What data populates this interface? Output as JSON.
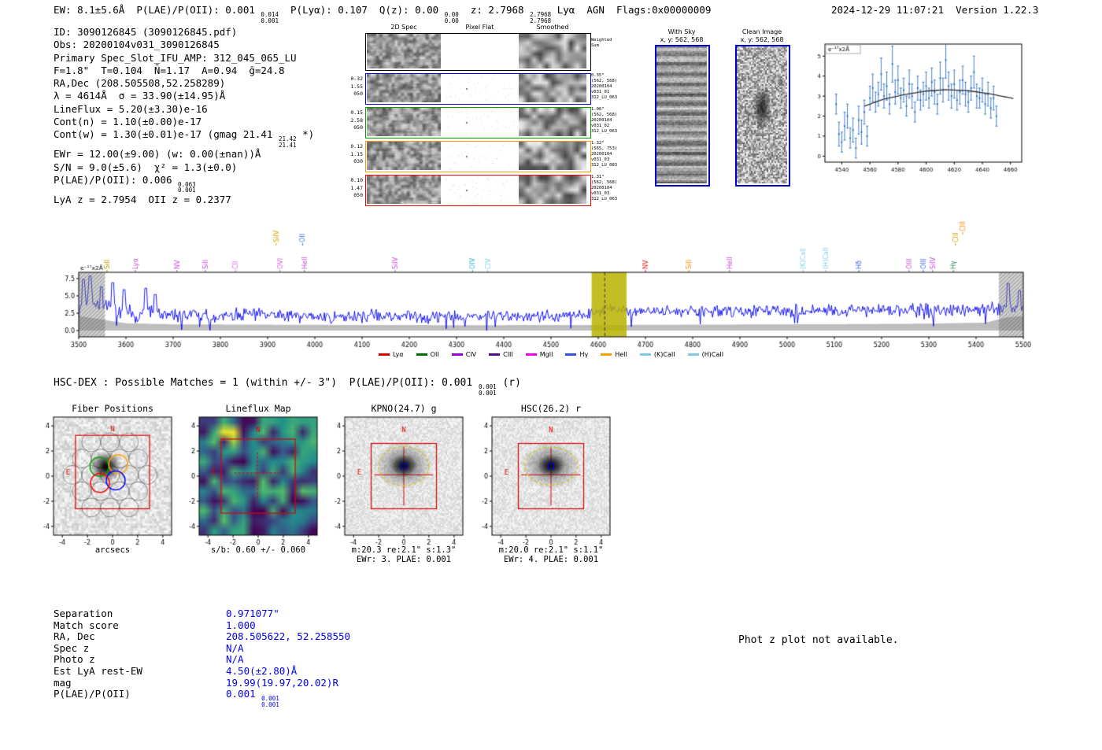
{
  "meta": {
    "datetime": "2024-12-29 11:07:21",
    "version": "Version 1.22.3"
  },
  "header": {
    "segments": [
      {
        "t": "EW: 8.1±5.6Å  P(LAE)/P(OII): 0.001 "
      },
      {
        "up": "0.014",
        "down": "0.001"
      },
      {
        "t": "  P(Lyα): 0.107  Q(z): 0.00 "
      },
      {
        "up": "0.00",
        "down": "0.00"
      },
      {
        "t": "  z: 2.7968 "
      },
      {
        "up": "2.7968",
        "down": "2.7968"
      },
      {
        "t": " Lyα  AGN  Flags:0x00000009"
      }
    ]
  },
  "info_block": {
    "lines": [
      [
        {
          "t": "ID: 3090126845 (3090126845.pdf)"
        }
      ],
      [
        {
          "t": "Obs: 20200104v031_3090126845"
        }
      ],
      [
        {
          "t": "Primary Spec_Slot_IFU_AMP: 312_045_065_LU"
        }
      ],
      [
        {
          "t": "F=1.8\"  T=0.104  N̄=1.17  A=0.94  ḡ=24.8"
        }
      ],
      [
        {
          "t": "RA,Dec (208.505508,52.258289)"
        }
      ],
      [
        {
          "t": "λ = 4614Å  σ = 33.90(±14.95)Å"
        }
      ],
      [
        {
          "t": "LineFlux = 5.20(±3.30)e-16"
        }
      ],
      [
        {
          "t": "Cont(n) = 1.10(±0.00)e-17"
        }
      ],
      [
        {
          "t": "Cont(w) = 1.30(±0.01)e-17 (gmag 21.41 "
        },
        {
          "up": "21.42",
          "down": "21.41"
        },
        {
          "t": " *)"
        }
      ],
      [
        {
          "t": "EWr = 12.00(±9.00) (w: 0.00(±nan))Å"
        }
      ],
      [
        {
          "t": "S/N = 9.0(±5.6)  χ² = 1.3(±0.0)"
        }
      ],
      [
        {
          "t": "P(LAE)/P(OII): 0.006 "
        },
        {
          "up": "0.063",
          "down": "0.001"
        }
      ],
      [
        {
          "t": "LyA z = 2.7954  OII z = 0.2377"
        }
      ]
    ]
  },
  "spec2d": {
    "col_headers": [
      "2D Spec",
      "Pixel Flat",
      "Smoothed"
    ],
    "weighted_row": {
      "right_label": [
        "Weighted",
        "Sum"
      ],
      "border": "#000000"
    },
    "rows": [
      {
        "left": [
          "0.32",
          "1.55",
          "050"
        ],
        "border": "#0000dd",
        "right": [
          "0.35\"",
          "(562, 568)",
          "20200104",
          "v031_01",
          "312_LU_063"
        ]
      },
      {
        "left": [
          "0.15",
          "2.58",
          "050"
        ],
        "border": "#00a000",
        "right": [
          "1.06\"",
          "(562, 568)",
          "20200104",
          "v031_02",
          "312_LU_063"
        ]
      },
      {
        "left": [
          "0.12",
          "1.15",
          "030"
        ],
        "border": "#ff9900",
        "right": [
          "1.32\"",
          "(565, 753)",
          "20200104",
          "v031_03",
          "312_LU_083"
        ]
      },
      {
        "left": [
          "0.10",
          "1.47",
          "050"
        ],
        "border": "#ee0000",
        "right": [
          "1.31\"",
          "(562, 568)",
          "20200104",
          "v031_03",
          "312_LU_063"
        ]
      }
    ]
  },
  "sky_panels": [
    {
      "title": "With Sky",
      "subtitle": "x, y: 562, 568",
      "border": "#0000cc"
    },
    {
      "title": "Clean Image",
      "subtitle": "x, y: 562, 568",
      "border": "#0000cc"
    }
  ],
  "hsc_line": {
    "segments": [
      {
        "t": "HSC-DEX : Possible Matches = 1 (within +/- 3\")  P(LAE)/P(OII): 0.001 "
      },
      {
        "up": "0.001",
        "down": "0.001"
      },
      {
        "t": " (r)"
      }
    ]
  },
  "cutouts": [
    {
      "title": "Fiber Positions",
      "xlabel": "arcsecs",
      "captions": []
    },
    {
      "title": "Lineflux Map",
      "captions": [
        "s/b: 0.60 +/- 0.060"
      ]
    },
    {
      "title": "KPNO(24.7) g",
      "captions": [
        "m:20.3 re:2.1\" s:1.3\"",
        "EWr: 3. PLAE: 0.001"
      ]
    },
    {
      "title": "HSC(26.2) r",
      "captions": [
        "m:20.0 re:2.1\" s:1.1\"",
        "EWr: 4. PLAE: 0.001"
      ]
    }
  ],
  "match_table": {
    "value_color": "#0000ee",
    "rows": [
      {
        "label": "Separation",
        "value": "0.971077\""
      },
      {
        "label": "Match score",
        "value": "1.000"
      },
      {
        "label": "RA, Dec",
        "value": "208.505622, 52.258550"
      },
      {
        "label": "Spec z",
        "value": "N/A"
      },
      {
        "label": "Photo z",
        "value": "N/A"
      },
      {
        "label": "Est LyA rest-EW",
        "value": "4.50(±2.80)Å"
      },
      {
        "label": "mag",
        "value": "19.99(19.97,20.02)R"
      },
      {
        "label": "P(LAE)/P(OII)",
        "value": "0.001",
        "stack": {
          "up": "0.001",
          "down": "0.001"
        }
      }
    ]
  },
  "notes": {
    "photz": "Phot z plot not available."
  },
  "chart_data": [
    {
      "id": "emission_line_fit_zoom",
      "type": "scatter",
      "ylabel_box": "e⁻¹⁷x2Å",
      "x_range": [
        4528,
        4668
      ],
      "y_range": [
        -0.3,
        5.6
      ],
      "x_ticks": [
        4540,
        4560,
        4580,
        4600,
        4620,
        4640,
        4660
      ],
      "y_ticks": [
        0,
        1,
        2,
        3,
        4,
        5
      ],
      "point_color": "#3070c0",
      "fit_color": "#303030",
      "x": [
        4536,
        4538,
        4540,
        4542,
        4544,
        4546,
        4548,
        4550,
        4552,
        4554,
        4556,
        4558,
        4560,
        4562,
        4564,
        4566,
        4568,
        4570,
        4572,
        4574,
        4576,
        4578,
        4580,
        4582,
        4584,
        4586,
        4588,
        4590,
        4592,
        4594,
        4596,
        4598,
        4600,
        4602,
        4604,
        4606,
        4608,
        4610,
        4612,
        4614,
        4616,
        4618,
        4620,
        4622,
        4624,
        4626,
        4628,
        4630,
        4632,
        4634,
        4636,
        4638,
        4640,
        4642,
        4644,
        4646,
        4648,
        4650
      ],
      "y": [
        2.6,
        1.1,
        0.7,
        1.5,
        2.0,
        0.9,
        1.3,
        0.4,
        1.8,
        1.2,
        2.2,
        1.0,
        2.9,
        3.4,
        2.7,
        3.1,
        4.1,
        3.0,
        3.5,
        2.6,
        4.6,
        3.2,
        3.8,
        2.9,
        3.3,
        2.5,
        3.6,
        3.0,
        2.2,
        3.4,
        2.8,
        3.1,
        3.5,
        2.9,
        3.7,
        3.2,
        2.6,
        3.9,
        3.3,
        4.8,
        3.5,
        3.0,
        3.6,
        2.8,
        3.2,
        3.8,
        3.1,
        2.7,
        3.4,
        4.2,
        3.0,
        2.9,
        3.3,
        2.6,
        3.1,
        2.4,
        2.9,
        2.0
      ],
      "yerr": [
        0.5,
        0.6,
        0.5,
        0.7,
        0.6,
        0.5,
        0.6,
        0.5,
        0.7,
        0.6,
        0.6,
        0.5,
        0.6,
        0.7,
        0.5,
        0.6,
        0.8,
        0.6,
        0.7,
        0.5,
        0.9,
        0.6,
        0.7,
        0.5,
        0.6,
        0.5,
        0.7,
        0.6,
        0.5,
        0.6,
        0.5,
        0.6,
        0.7,
        0.5,
        0.7,
        0.6,
        0.5,
        0.8,
        0.6,
        0.9,
        0.7,
        0.6,
        0.7,
        0.5,
        0.6,
        0.7,
        0.6,
        0.5,
        0.6,
        0.8,
        0.6,
        0.5,
        0.6,
        0.5,
        0.6,
        0.5,
        0.6,
        0.5
      ],
      "fit_curve": [
        [
          4556,
          2.5
        ],
        [
          4570,
          2.85
        ],
        [
          4585,
          3.08
        ],
        [
          4600,
          3.25
        ],
        [
          4614,
          3.32
        ],
        [
          4630,
          3.27
        ],
        [
          4645,
          3.12
        ],
        [
          4662,
          2.88
        ]
      ]
    },
    {
      "id": "full_width_spectrum",
      "type": "line",
      "ylabel": "e⁻¹⁷x2Å",
      "x_range": [
        3500,
        5500
      ],
      "y_range": [
        -0.9,
        8.4
      ],
      "x_ticks": [
        3500,
        3600,
        3700,
        3800,
        3900,
        4000,
        4100,
        4200,
        4300,
        4400,
        4500,
        4600,
        4700,
        4800,
        4900,
        5000,
        5100,
        5200,
        5300,
        5400,
        5500
      ],
      "y_ticks": [
        0.0,
        2.5,
        5.0,
        7.5
      ],
      "line_color": "#0000ee",
      "continuum_fill_color": "#bdbdbd",
      "noise_seed": 11,
      "mean_keypoints": [
        [
          3500,
          3.4
        ],
        [
          3520,
          4.2
        ],
        [
          3560,
          2.9
        ],
        [
          3620,
          2.5
        ],
        [
          3700,
          2.2
        ],
        [
          3800,
          2.1
        ],
        [
          3900,
          2.2
        ],
        [
          4000,
          2.0
        ],
        [
          4100,
          2.1
        ],
        [
          4250,
          2.0
        ],
        [
          4400,
          2.1
        ],
        [
          4520,
          2.0
        ],
        [
          4580,
          2.3
        ],
        [
          4614,
          3.1
        ],
        [
          4660,
          2.8
        ],
        [
          4750,
          2.7
        ],
        [
          4900,
          2.8
        ],
        [
          5050,
          2.8
        ],
        [
          5200,
          2.9
        ],
        [
          5350,
          2.9
        ],
        [
          5460,
          3.1
        ],
        [
          5500,
          3.3
        ]
      ],
      "noise_keypoints": [
        [
          3500,
          2.6
        ],
        [
          3560,
          2.2
        ],
        [
          3620,
          1.3
        ],
        [
          3700,
          1.1
        ],
        [
          4000,
          1.0
        ],
        [
          4400,
          0.9
        ],
        [
          4600,
          0.8
        ],
        [
          4700,
          0.95
        ],
        [
          5200,
          0.95
        ],
        [
          5420,
          1.0
        ],
        [
          5500,
          1.4
        ]
      ],
      "gray_band_keypoints": [
        [
          3500,
          2.1
        ],
        [
          3540,
          1.7
        ],
        [
          3600,
          1.05
        ],
        [
          3700,
          0.9
        ],
        [
          4000,
          0.82
        ],
        [
          4300,
          0.78
        ],
        [
          4600,
          0.8
        ],
        [
          4800,
          0.85
        ],
        [
          5100,
          0.92
        ],
        [
          5300,
          1.0
        ],
        [
          5420,
          1.15
        ],
        [
          5465,
          1.9
        ],
        [
          5500,
          2.1
        ]
      ],
      "spikes": [
        [
          3510,
          7.4
        ],
        [
          3524,
          7.9
        ],
        [
          3548,
          6.3
        ],
        [
          3572,
          6.9
        ],
        [
          3596,
          5.9
        ],
        [
          3642,
          6.1
        ],
        [
          3662,
          5.2
        ],
        [
          5468,
          6.8
        ],
        [
          5492,
          5.8
        ]
      ],
      "highlight_band": {
        "x0": 4586,
        "x1": 4660,
        "color": "rgba(185,178,0,0.85)"
      },
      "dashed_line_x": 4614,
      "hatched_bands": [
        [
          3500,
          3556
        ],
        [
          5448,
          5500
        ]
      ],
      "line_labels": [
        {
          "name": "SiII",
          "wl": 3560,
          "color": "#b8a000",
          "level": 1
        },
        {
          "name": "Lyα",
          "wl": 3620,
          "color": "#c050d0",
          "level": 1
        },
        {
          "name": "NV",
          "wl": 3708,
          "color": "#c050d0",
          "level": 1
        },
        {
          "name": "SiII",
          "wl": 3768,
          "color": "#c050d0",
          "level": 1
        },
        {
          "name": "CII",
          "wl": 3832,
          "color": "#e060e0",
          "level": 1
        },
        {
          "name": "SiIV",
          "wl": 3918,
          "color": "#c8a800",
          "level": 2
        },
        {
          "name": "OVI",
          "wl": 3926,
          "color": "#e060e0",
          "level": 1
        },
        {
          "name": "OII",
          "wl": 3974,
          "color": "#4169e1",
          "level": 2
        },
        {
          "name": "HeII",
          "wl": 3978,
          "color": "#c050d0",
          "level": 1
        },
        {
          "name": "SiIV",
          "wl": 4170,
          "color": "#c050d0",
          "level": 1
        },
        {
          "name": "OIV",
          "wl": 4334,
          "color": "#30b8c8",
          "level": 1
        },
        {
          "name": "CIV",
          "wl": 4366,
          "color": "#87ceeb",
          "level": 1
        },
        {
          "name": "NV",
          "wl": 4700,
          "color": "#e02020",
          "level": 1
        },
        {
          "name": "SiII",
          "wl": 4792,
          "color": "#ff8c00",
          "level": 1
        },
        {
          "name": "HeII",
          "wl": 4878,
          "color": "#c050d0",
          "level": 1
        },
        {
          "name": "(K)CaII",
          "wl": 5034,
          "color": "#87ceeb",
          "level": 1
        },
        {
          "name": "(H)CaII",
          "wl": 5082,
          "color": "#87ceeb",
          "level": 1
        },
        {
          "name": "Hδ",
          "wl": 5152,
          "color": "#4169e1",
          "level": 1
        },
        {
          "name": "OIII",
          "wl": 5258,
          "color": "#c050d0",
          "level": 1
        },
        {
          "name": "OIII",
          "wl": 5288,
          "color": "#4169e1",
          "level": 1
        },
        {
          "name": "SiIV",
          "wl": 5308,
          "color": "#c050d0",
          "level": 1
        },
        {
          "name": "Hγ",
          "wl": 5352,
          "color": "#2e8b57",
          "level": 1
        },
        {
          "name": "CIII",
          "wl": 5356,
          "color": "#c8a800",
          "level": 2
        },
        {
          "name": "CIII",
          "wl": 5372,
          "color": "#ff8c00",
          "level": 3
        }
      ],
      "legend": [
        {
          "label": "Lyα",
          "color": "#e00000"
        },
        {
          "label": "OII",
          "color": "#007000"
        },
        {
          "label": "CIV",
          "color": "#9400d3"
        },
        {
          "label": "CIII",
          "color": "#5a0a8a"
        },
        {
          "label": "MgII",
          "color": "#ee00ee"
        },
        {
          "label": "Hγ",
          "color": "#3355dd"
        },
        {
          "label": "HeII",
          "color": "#ff9900"
        },
        {
          "label": "(K)CaII",
          "color": "#7ec8e3"
        },
        {
          "label": "(H)CaII",
          "color": "#7ec8e3"
        }
      ]
    }
  ]
}
